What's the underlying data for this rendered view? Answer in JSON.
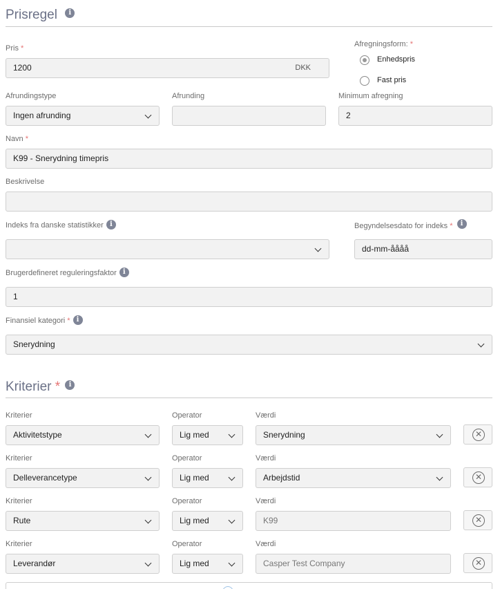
{
  "prisregel": {
    "title": "Prisregel"
  },
  "pris": {
    "label": "Pris",
    "value": "1200",
    "currency": "DKK"
  },
  "afregningsform": {
    "label": "Afregningsform:",
    "options": [
      {
        "label": "Enhedspris",
        "checked": true
      },
      {
        "label": "Fast pris",
        "checked": false
      }
    ]
  },
  "afrundingstype": {
    "label": "Afrundingstype",
    "value": "Ingen afrunding"
  },
  "afrunding": {
    "label": "Afrunding",
    "value": ""
  },
  "minimum_afregning": {
    "label": "Minimum afregning",
    "value": "2"
  },
  "navn": {
    "label": "Navn",
    "value": "K99 - Snerydning timepris"
  },
  "beskrivelse": {
    "label": "Beskrivelse",
    "value": ""
  },
  "indeks": {
    "label": "Indeks fra danske statistikker",
    "value": ""
  },
  "begyndelsesdato": {
    "label": "Begyndelsesdato for indeks",
    "value": "dd-mm-åååå"
  },
  "reguleringsfaktor": {
    "label": "Brugerdefineret reguleringsfaktor",
    "value": "1"
  },
  "finansiel_kategori": {
    "label": "Finansiel kategori",
    "value": "Snerydning"
  },
  "kriterier": {
    "title": "Kriterier",
    "col_labels": {
      "kriterie": "Kriterier",
      "operator": "Operator",
      "vaerdi": "Værdi"
    },
    "rows": [
      {
        "kriterie": "Aktivitetstype",
        "operator": "Lig med",
        "vaerdi": "Snerydning",
        "vaerdi_dropdown": true
      },
      {
        "kriterie": "Delleverancetype",
        "operator": "Lig med",
        "vaerdi": "Arbejdstid",
        "vaerdi_dropdown": true
      },
      {
        "kriterie": "Rute",
        "operator": "Lig med",
        "vaerdi": "K99",
        "vaerdi_dropdown": false
      },
      {
        "kriterie": "Leverandør",
        "operator": "Lig med",
        "vaerdi": "Casper Test Company",
        "vaerdi_dropdown": false
      }
    ]
  },
  "icons": {
    "info": "info-icon",
    "remove": "close-circle-icon",
    "chevron": "chevron-down-icon"
  },
  "colors": {
    "title": "#6b7187",
    "required": "#e57373",
    "field_bg": "#f2f2f2"
  }
}
